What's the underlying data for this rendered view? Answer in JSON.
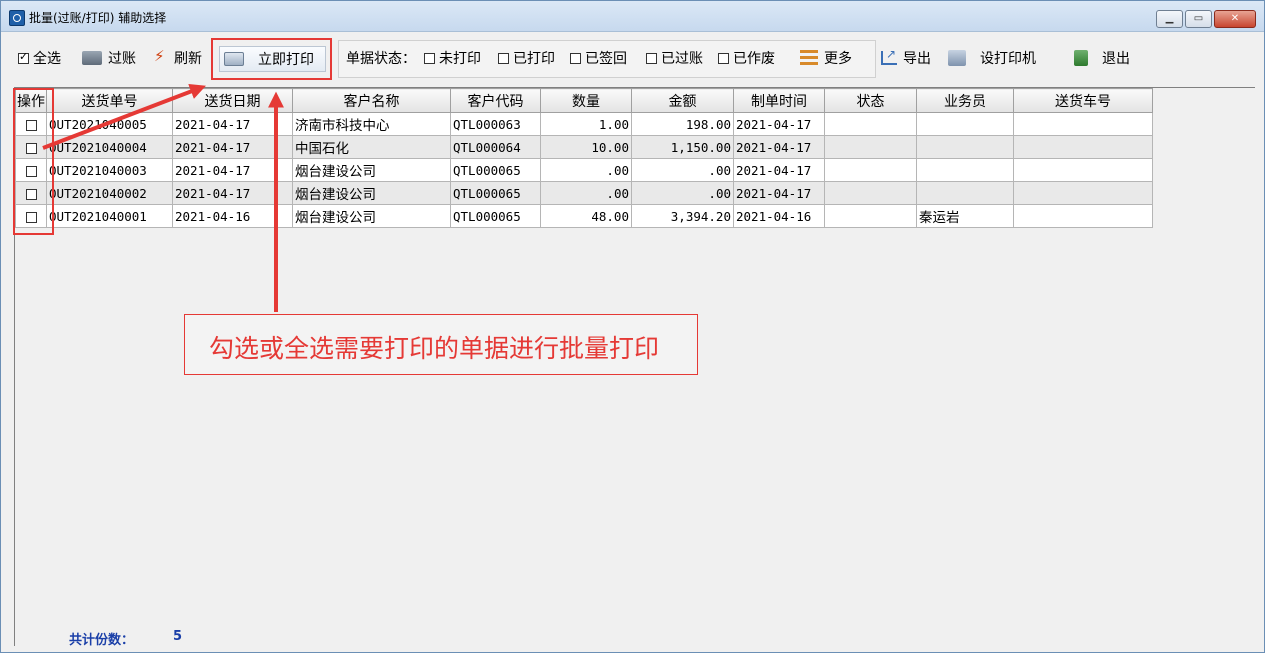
{
  "window": {
    "title": "批量(过账/打印) 辅助选择"
  },
  "toolbar": {
    "select_all_label": "全选",
    "post_label": "过账",
    "refresh_label": "刷新",
    "print_now_label": "立即打印",
    "status_label": "单据状态：",
    "filters": [
      "未打印",
      "已打印",
      "已签回",
      "已过账",
      "已作废"
    ],
    "more_label": "更多",
    "export_label": "导出",
    "printer_setup_label": "设打印机",
    "exit_label": "退出"
  },
  "grid": {
    "columns": [
      "操作",
      "送货单号",
      "送货日期",
      "客户名称",
      "客户代码",
      "数量",
      "金额",
      "制单时间",
      "状态",
      "业务员",
      "送货车号"
    ],
    "rows": [
      {
        "no": "OUT2021040005",
        "date": "2021-04-17",
        "customer": "济南市科技中心",
        "code": "QTL000063",
        "qty": "1.00",
        "amount": "198.00",
        "created": "2021-04-17",
        "status": "",
        "salesman": "",
        "vehicle": ""
      },
      {
        "no": "OUT2021040004",
        "date": "2021-04-17",
        "customer": "中国石化",
        "code": "QTL000064",
        "qty": "10.00",
        "amount": "1,150.00",
        "created": "2021-04-17",
        "status": "",
        "salesman": "",
        "vehicle": ""
      },
      {
        "no": "OUT2021040003",
        "date": "2021-04-17",
        "customer": "烟台建设公司",
        "code": "QTL000065",
        "qty": ".00",
        "amount": ".00",
        "created": "2021-04-17",
        "status": "",
        "salesman": "",
        "vehicle": ""
      },
      {
        "no": "OUT2021040002",
        "date": "2021-04-17",
        "customer": "烟台建设公司",
        "code": "QTL000065",
        "qty": ".00",
        "amount": ".00",
        "created": "2021-04-17",
        "status": "",
        "salesman": "",
        "vehicle": ""
      },
      {
        "no": "OUT2021040001",
        "date": "2021-04-16",
        "customer": "烟台建设公司",
        "code": "QTL000065",
        "qty": "48.00",
        "amount": "3,394.20",
        "created": "2021-04-16",
        "status": "",
        "salesman": "秦运岩",
        "vehicle": ""
      }
    ]
  },
  "footer": {
    "total_label": "共计份数：",
    "total_count": "5"
  },
  "annotation": {
    "text": "勾选或全选需要打印的单据进行批量打印",
    "color": "#e53935"
  }
}
